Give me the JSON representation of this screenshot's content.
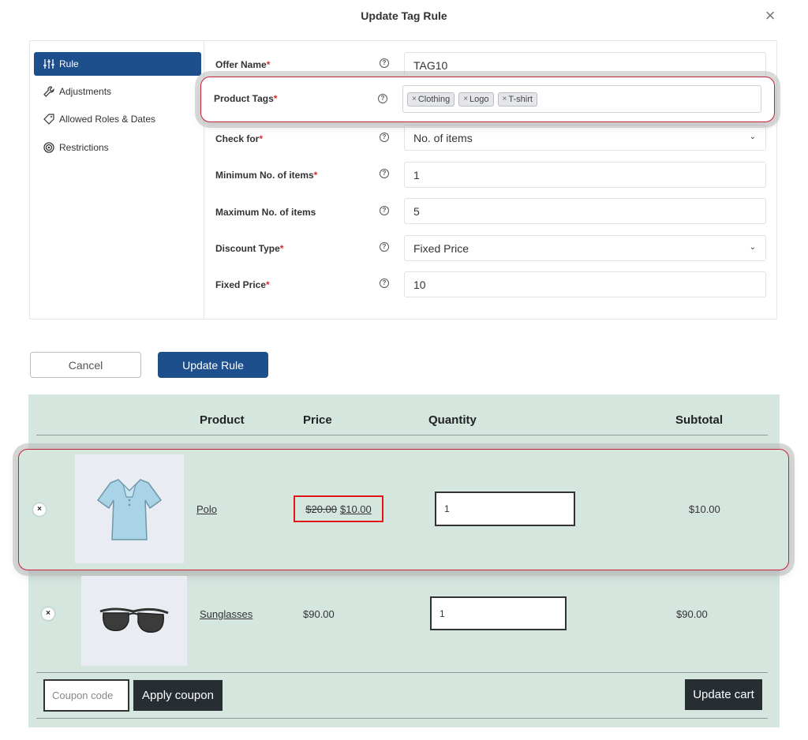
{
  "dialog": {
    "title": "Update Tag Rule",
    "close_label": "×"
  },
  "sidebar": {
    "items": [
      {
        "label": "Rule",
        "icon": "sliders-icon"
      },
      {
        "label": "Adjustments",
        "icon": "wrench-icon"
      },
      {
        "label": "Allowed Roles & Dates",
        "icon": "tag-icon"
      },
      {
        "label": "Restrictions",
        "icon": "target-icon"
      }
    ]
  },
  "form": {
    "offer_name": {
      "label": "Offer Name",
      "value": "TAG10"
    },
    "product_tags": {
      "label": "Product Tags",
      "tags": [
        "Clothing",
        "Logo",
        "T-shirt"
      ]
    },
    "check_for": {
      "label": "Check for",
      "value": "No. of items"
    },
    "min_items": {
      "label": "Minimum No. of items",
      "value": "1"
    },
    "max_items": {
      "label": "Maximum No. of items",
      "value": "5"
    },
    "discount_type": {
      "label": "Discount Type",
      "value": "Fixed Price"
    },
    "fixed_price": {
      "label": "Fixed Price",
      "value": "10"
    },
    "required_marker": "*",
    "help_glyph": "?",
    "chip_remove": "×",
    "chevron": "⌄"
  },
  "actions": {
    "cancel_label": "Cancel",
    "update_label": "Update Rule"
  },
  "cart": {
    "headers": {
      "product": "Product",
      "price": "Price",
      "quantity": "Quantity",
      "subtotal": "Subtotal"
    },
    "remove_glyph": "×",
    "rows": [
      {
        "name": "Polo",
        "old_price": "$20.00",
        "price": "$10.00",
        "quantity": "1",
        "subtotal": "$10.00"
      },
      {
        "name": "Sunglasses",
        "price": "$90.00",
        "quantity": "1",
        "subtotal": "$90.00"
      }
    ],
    "coupon_placeholder": "Coupon code",
    "apply_coupon_label": "Apply coupon",
    "update_cart_label": "Update cart"
  },
  "colors": {
    "primary": "#1d4f8c",
    "highlight": "#c82333",
    "cart_bg": "#d5e6df",
    "dark_button": "#262d33"
  }
}
